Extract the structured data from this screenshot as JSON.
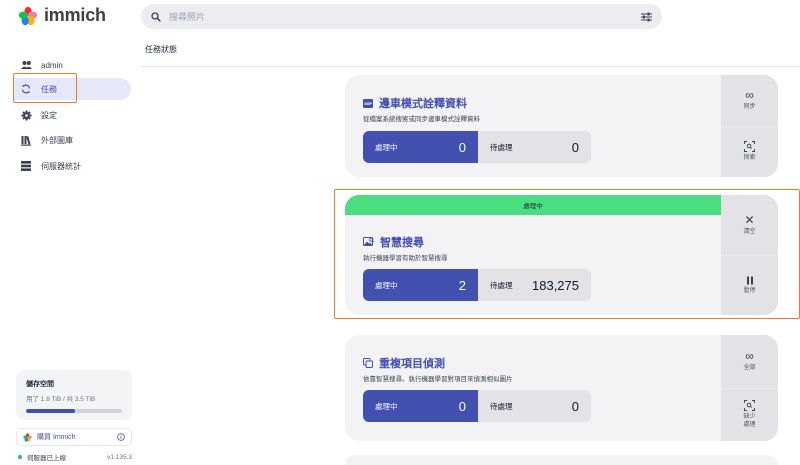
{
  "app": {
    "name": "immich"
  },
  "search": {
    "placeholder": "搜尋照片"
  },
  "sidebar": {
    "items": [
      {
        "label": "admin",
        "icon": "users-icon"
      },
      {
        "label": "任務",
        "icon": "sync-icon",
        "active": true
      },
      {
        "label": "設定",
        "icon": "gear-icon"
      },
      {
        "label": "外部圖庫",
        "icon": "library-icon"
      },
      {
        "label": "伺服器統計",
        "icon": "server-icon"
      }
    ],
    "storage": {
      "title": "儲存空間",
      "usage": "用了 1.8 TiB / 共 3.5 TiB",
      "used_fraction": 0.51
    },
    "buy_label": "購買 Immich",
    "server_status": "伺服器已上線",
    "version": "v1.135.3"
  },
  "page": {
    "title": "任務狀態"
  },
  "jobs": [
    {
      "title": "邊車模式詮釋資料",
      "description": "從檔案系統搜索或同步邊車模式詮釋資料",
      "active_label": "處理中",
      "active_count": "0",
      "waiting_label": "待處理",
      "waiting_count": "0",
      "actions": [
        {
          "label": "同步",
          "icon": "infinity-icon"
        },
        {
          "label": "探索",
          "icon": "scan-icon"
        }
      ]
    },
    {
      "title": "智慧搜尋",
      "description": "執行機器學習有助於智慧搜尋",
      "running_banner": "處理中",
      "active_label": "處理中",
      "active_count": "2",
      "waiting_label": "待處理",
      "waiting_count": "183,275",
      "actions": [
        {
          "label": "清空",
          "icon": "close-icon"
        },
        {
          "label": "暫停",
          "icon": "pause-icon"
        }
      ]
    },
    {
      "title": "重複項目偵測",
      "description": "依靠智慧搜尋。執行機器學習對項目來偵測相似圖片",
      "active_label": "處理中",
      "active_count": "0",
      "waiting_label": "待處理",
      "waiting_count": "0",
      "actions": [
        {
          "label": "全部",
          "icon": "infinity-icon"
        },
        {
          "label": "缺少\n處理",
          "icon": "scan-icon"
        }
      ]
    }
  ],
  "colors": {
    "primary": "#4250af",
    "running": "#4ade80",
    "highlight": "#ef7b2d"
  }
}
